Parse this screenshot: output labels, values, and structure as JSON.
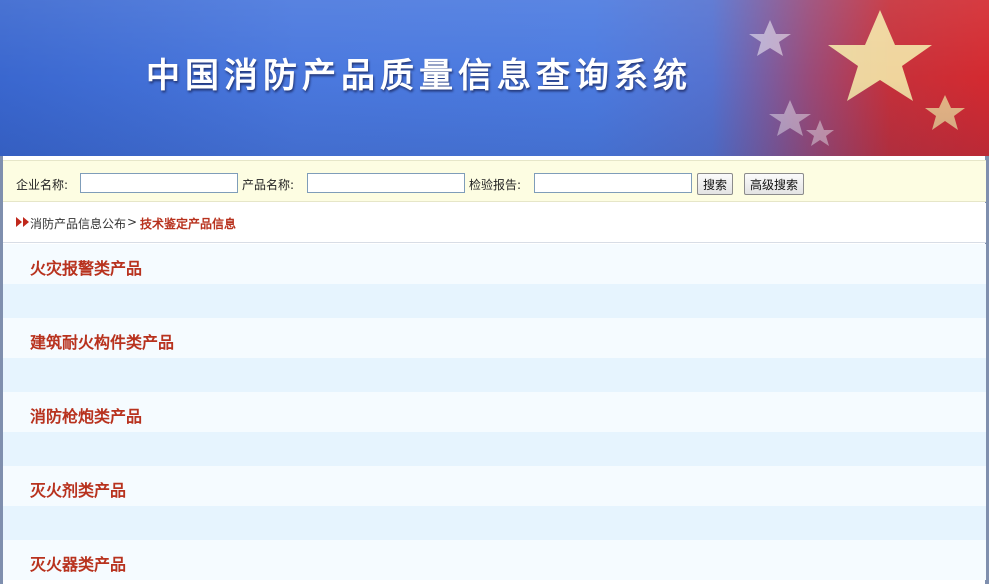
{
  "banner": {
    "title": "中国消防产品质量信息查询系统"
  },
  "search": {
    "company_label": "企业名称:",
    "company_value": "",
    "product_label": "产品名称:",
    "product_value": "",
    "report_label": "检验报告:",
    "report_value": "",
    "search_button": "搜索",
    "advanced_button": "高级搜索"
  },
  "breadcrumb": {
    "parent": "消防产品信息公布",
    "separator": ">",
    "current": "技术鉴定产品信息"
  },
  "categories": [
    {
      "label": "火灾报警类产品"
    },
    {
      "label": "建筑耐火构件类产品"
    },
    {
      "label": "消防枪炮类产品"
    },
    {
      "label": "灭火剂类产品"
    },
    {
      "label": "灭火器类产品"
    }
  ],
  "colors": {
    "banner_blue": "#4a78de",
    "flag_red": "#d42a30",
    "link_red": "#b8321e",
    "search_bar_bg": "#fdfde2",
    "row_light": "#f5fbff",
    "row_blue": "#e6f4fe"
  }
}
